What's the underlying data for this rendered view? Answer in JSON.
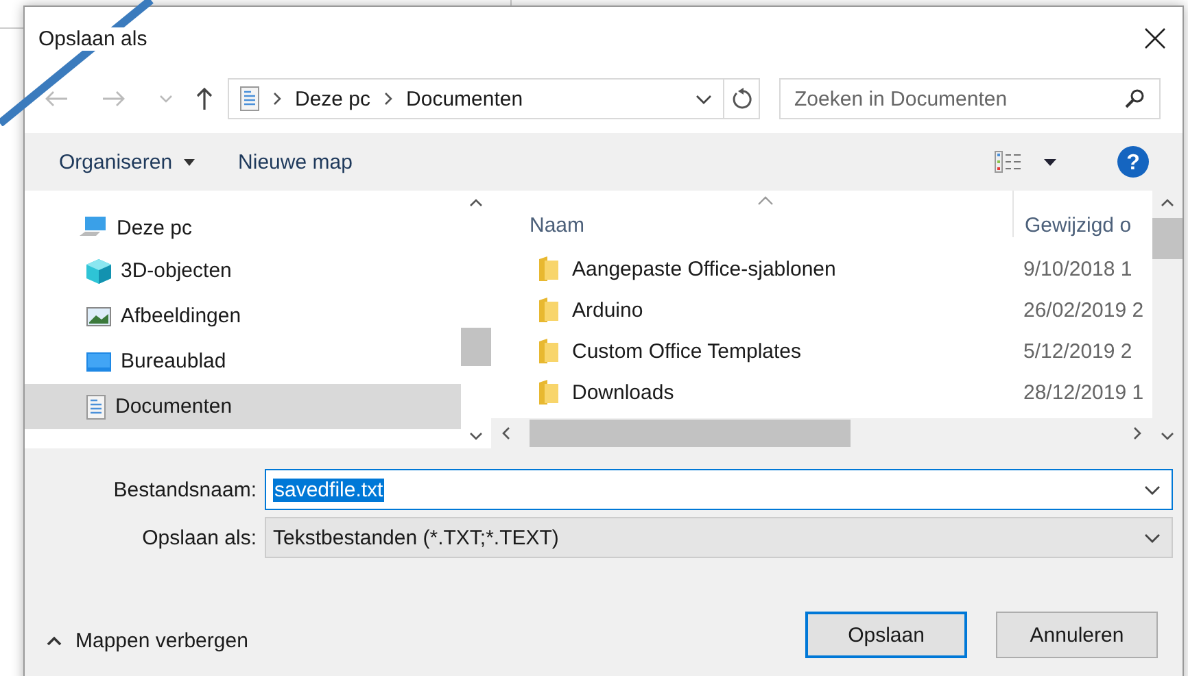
{
  "window": {
    "title": "Opslaan als"
  },
  "address": {
    "path": [
      "Deze pc",
      "Documenten"
    ]
  },
  "search": {
    "placeholder": "Zoeken in Documenten"
  },
  "toolbar": {
    "organize": "Organiseren",
    "new_folder": "Nieuwe map",
    "help": "?"
  },
  "sidebar": {
    "items": [
      {
        "label": "Deze pc",
        "kind": "pc",
        "selected": false,
        "children": [
          {
            "label": "3D-objecten",
            "kind": "cube",
            "selected": false
          },
          {
            "label": "Afbeeldingen",
            "kind": "pictures",
            "selected": false
          },
          {
            "label": "Bureaublad",
            "kind": "desktop",
            "selected": false
          },
          {
            "label": "Documenten",
            "kind": "documents",
            "selected": true
          }
        ]
      }
    ]
  },
  "table": {
    "columns": [
      "Naam",
      "Gewijzigd o"
    ],
    "rows": [
      {
        "name": "Aangepaste Office-sjablonen",
        "date": "9/10/2018 1"
      },
      {
        "name": "Arduino",
        "date": "26/02/2019 2"
      },
      {
        "name": "Custom Office Templates",
        "date": "5/12/2019 2"
      },
      {
        "name": "Downloads",
        "date": "28/12/2019 1"
      }
    ]
  },
  "form": {
    "filename_label": "Bestandsnaam:",
    "filename": "savedfile.txt",
    "type_label": "Opslaan als:",
    "type": "Tekstbestanden (*.TXT;*.TEXT)"
  },
  "footer": {
    "toggle": "Mappen verbergen",
    "buttons": [
      {
        "label": "Opslaan",
        "default": true
      },
      {
        "label": "Annuleren",
        "default": false
      }
    ]
  }
}
